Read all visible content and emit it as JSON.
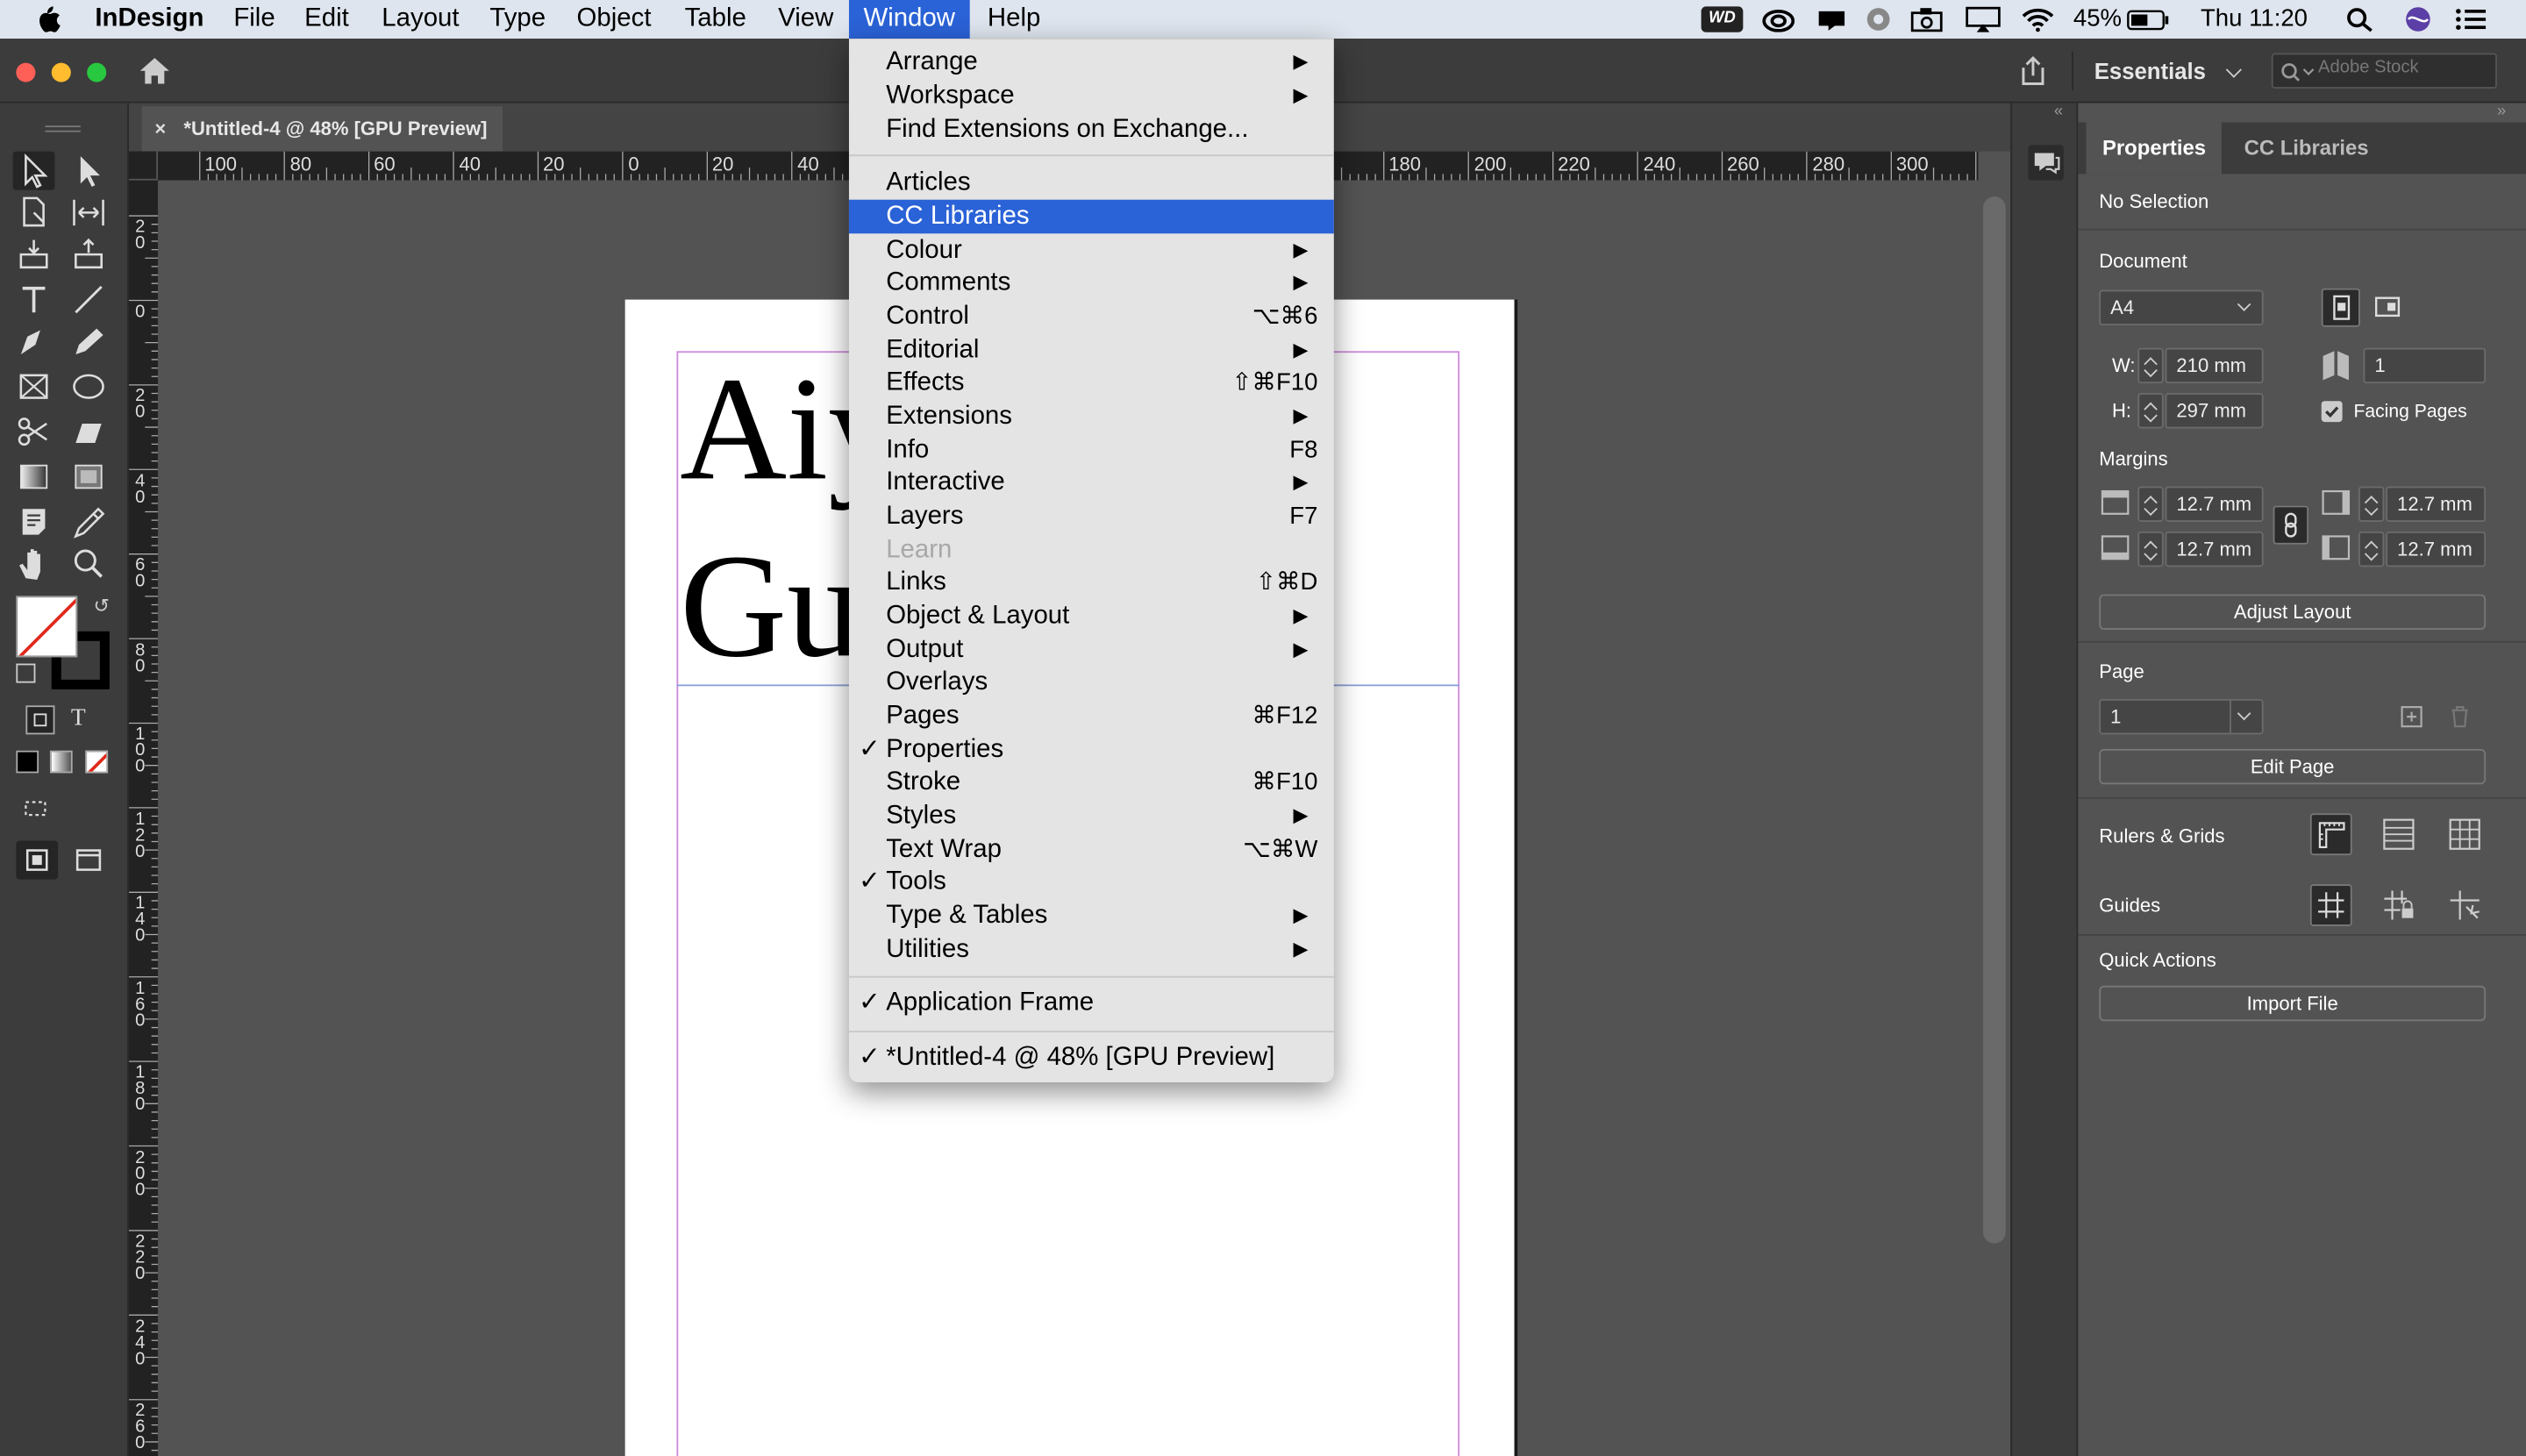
{
  "menubar": {
    "items": [
      "InDesign",
      "File",
      "Edit",
      "Layout",
      "Type",
      "Object",
      "Table",
      "View",
      "Window",
      "Help"
    ],
    "active": "Window",
    "status": {
      "wd_badge": "WD",
      "battery": "45%",
      "clock": "Thu 11:20"
    }
  },
  "appbar": {
    "workspace": "Essentials",
    "search_placeholder": "Adobe Stock"
  },
  "doc_tab": {
    "title": "*Untitled-4 @ 48% [GPU Preview]",
    "close": "×"
  },
  "rulers": {
    "horizontal": [
      "100",
      "80",
      "60",
      "40",
      "20",
      "0",
      "20",
      "40",
      "180",
      "200",
      "220",
      "240",
      "260",
      "280",
      "300"
    ],
    "vertical": [
      "2\n0",
      "0",
      "2\n0",
      "4\n0",
      "6\n0",
      "8\n0",
      "1\n0\n0",
      "1\n2\n0",
      "1\n4\n0",
      "1\n6\n0",
      "1\n8\n0",
      "2\n0\n0",
      "2\n2\n0",
      "2\n4\n0",
      "2\n6\n0"
    ]
  },
  "document_text": {
    "line1": "Aiy",
    "line2": "Gu"
  },
  "window_menu": {
    "items": [
      {
        "label": "Arrange",
        "submenu": true
      },
      {
        "label": "Workspace",
        "submenu": true
      },
      {
        "label": "Find Extensions on Exchange..."
      },
      {
        "label": "Articles"
      },
      {
        "label": "CC Libraries",
        "highlighted": true
      },
      {
        "label": "Colour",
        "submenu": true
      },
      {
        "label": "Comments",
        "submenu": true
      },
      {
        "label": "Control",
        "shortcut": "⌥⌘6"
      },
      {
        "label": "Editorial",
        "submenu": true
      },
      {
        "label": "Effects",
        "shortcut": "⇧⌘F10"
      },
      {
        "label": "Extensions",
        "submenu": true
      },
      {
        "label": "Info",
        "shortcut": "F8"
      },
      {
        "label": "Interactive",
        "submenu": true
      },
      {
        "label": "Layers",
        "shortcut": "F7"
      },
      {
        "label": "Learn",
        "disabled": true
      },
      {
        "label": "Links",
        "shortcut": "⇧⌘D"
      },
      {
        "label": "Object & Layout",
        "submenu": true
      },
      {
        "label": "Output",
        "submenu": true
      },
      {
        "label": "Overlays"
      },
      {
        "label": "Pages",
        "shortcut": "⌘F12"
      },
      {
        "label": "Properties",
        "checked": true
      },
      {
        "label": "Stroke",
        "shortcut": "⌘F10"
      },
      {
        "label": "Styles",
        "submenu": true
      },
      {
        "label": "Text Wrap",
        "shortcut": "⌥⌘W"
      },
      {
        "label": "Tools",
        "checked": true
      },
      {
        "label": "Type & Tables",
        "submenu": true
      },
      {
        "label": "Utilities",
        "submenu": true
      },
      {
        "label": "Application Frame",
        "checked": true
      },
      {
        "label": "*Untitled-4 @ 48% [GPU Preview]",
        "checked": true
      }
    ],
    "submenu_glyph": "▶",
    "check_glyph": "✓"
  },
  "panel": {
    "tabs": [
      "Properties",
      "CC Libraries"
    ],
    "active_tab": "Properties",
    "selection": "No Selection",
    "document_label": "Document",
    "page_size": "A4",
    "w_label": "W:",
    "width": "210 mm",
    "h_label": "H:",
    "height": "297 mm",
    "pages_count": "1",
    "facing_pages_label": "Facing Pages",
    "facing_pages_checked": true,
    "margins_label": "Margins",
    "margin_top": "12.7 mm",
    "margin_bottom": "12.7 mm",
    "margin_left": "12.7 mm",
    "margin_right": "12.7 mm",
    "adjust_layout": "Adjust Layout",
    "page_label": "Page",
    "page_value": "1",
    "edit_page": "Edit Page",
    "rulers_grids": "Rulers & Grids",
    "guides": "Guides",
    "quick_actions": "Quick Actions",
    "import_file": "Import File"
  },
  "colors": {
    "accent": "#2a62d7",
    "margin_guide": "#cf8bde",
    "panel_bg": "#535353",
    "chrome": "#3c3c3c"
  }
}
